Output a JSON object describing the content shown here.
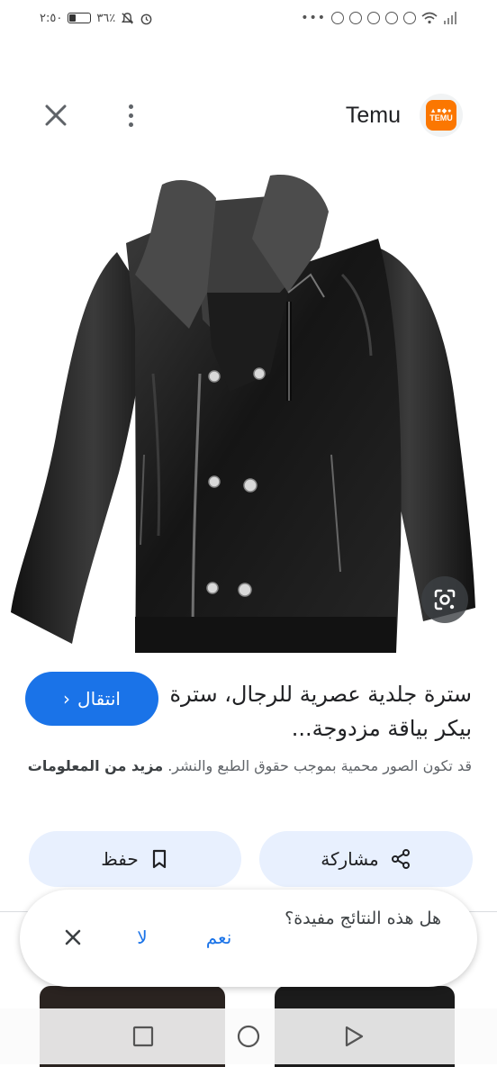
{
  "status_bar": {
    "time": "٢:٥٠",
    "battery": "٣٦٪",
    "battery_level": 0.36
  },
  "header": {
    "site_name": "Temu",
    "logo_text": "TEMU",
    "close_icon": "close-icon",
    "more_icon": "more-vert-icon"
  },
  "image": {
    "subject": "black-leather-jacket",
    "lens_icon": "google-lens-icon"
  },
  "result": {
    "title": "سترة جلدية عصرية للرجال، سترة بيكر بياقة مزدوجة...",
    "visit_label": "انتقال",
    "copyright_text": "قد تكون الصور محمية بموجب حقوق الطبع والنشر.",
    "more_info_label": "مزيد من المعلومات"
  },
  "actions": {
    "share_label": "مشاركة",
    "save_label": "حفظ"
  },
  "feedback": {
    "question": "هل هذه النتائج مفيدة؟",
    "yes_label": "نعم",
    "no_label": "لا"
  },
  "colors": {
    "accent": "#1a73e8",
    "chip_bg": "#e8f0fe",
    "brand": "#fb7701"
  }
}
